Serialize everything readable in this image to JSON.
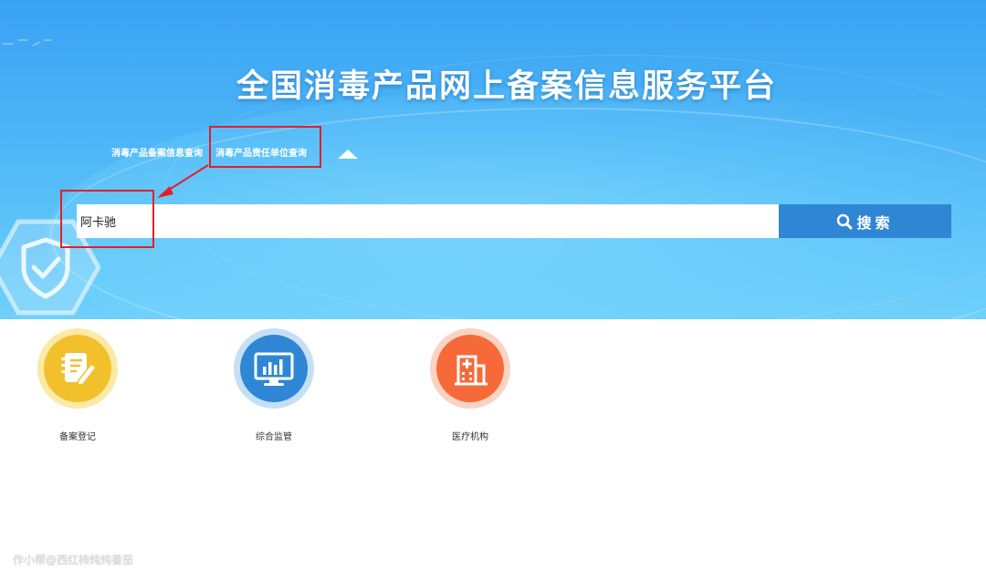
{
  "header": {
    "title": "全国消毒产品网上备案信息服务平台"
  },
  "tabs": [
    {
      "label": "消毒产品备案信息查询"
    },
    {
      "label": "消毒产品责任单位查询"
    }
  ],
  "search": {
    "value": "阿卡驰",
    "button_label": "搜索",
    "icon": "search-icon"
  },
  "features": [
    {
      "label": "备案登记",
      "icon": "register-notepad-icon",
      "color": "#f2c02b",
      "ring": "#fbe9a6"
    },
    {
      "label": "综合监管",
      "icon": "monitor-chart-icon",
      "color": "#2f86d4",
      "ring": "#c5e0f5"
    },
    {
      "label": "医疗机构",
      "icon": "hospital-icon",
      "color": "#f56a38",
      "ring": "#fbd3c2"
    }
  ],
  "colors": {
    "banner_top": "#3aa2f3",
    "banner_bottom": "#6fd0fb",
    "search_button": "#2f86d4",
    "annotation": "#e0202a"
  },
  "watermark": "作小帮@西红柿炖炖番茄"
}
